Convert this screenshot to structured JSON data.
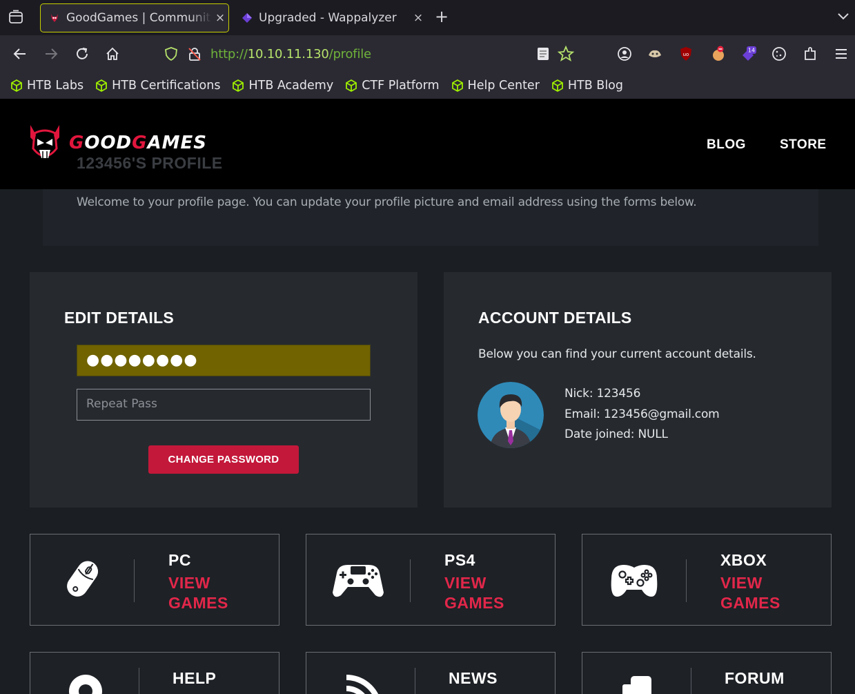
{
  "browser": {
    "tabs": [
      {
        "title": "GoodGames | Community and Store HTML Game Template",
        "active": true
      },
      {
        "title": "Upgraded - Wappalyzer",
        "active": false
      }
    ],
    "close_glyph": "×",
    "new_tab_glyph": "+",
    "url_prefix": "http://",
    "url_host": "10.10.11.130",
    "url_path": "/profile",
    "bookmarks": [
      "HTB Labs",
      "HTB Certifications",
      "HTB Academy",
      "CTF Platform",
      "Help Center",
      "HTB Blog"
    ],
    "extension_badge": "14",
    "accent_color": "#c8d000"
  },
  "site": {
    "logo_first": "G",
    "logo_mid": "OOD",
    "logo_g2": "G",
    "logo_rest": "AMES",
    "nav": [
      "BLOG",
      "STORE"
    ],
    "profile_title": "123456'S PROFILE",
    "welcome": "Welcome to your profile page. You can update your profile picture and email address using the forms below.",
    "brand_color": "#e2163d"
  },
  "edit": {
    "title": "EDIT DETAILS",
    "password_value": "●●●●●●●●",
    "repeat_placeholder": "Repeat Pass",
    "button": "CHANGE PASSWORD"
  },
  "account": {
    "title": "ACCOUNT DETAILS",
    "description": "Below you can find your current account details.",
    "nick": "Nick: 123456",
    "email": "Email: 123456@gmail.com",
    "joined": "Date joined: NULL"
  },
  "categories": [
    {
      "name": "PC",
      "link1": "VIEW",
      "link2": "GAMES",
      "icon": "mouse-icon"
    },
    {
      "name": "PS4",
      "link1": "VIEW",
      "link2": "GAMES",
      "icon": "ps4-controller-icon"
    },
    {
      "name": "XBOX",
      "link1": "VIEW",
      "link2": "GAMES",
      "icon": "xbox-controller-icon"
    },
    {
      "name": "HELP",
      "icon": "lifebuoy-icon"
    },
    {
      "name": "NEWS",
      "icon": "rss-icon"
    },
    {
      "name": "FORUM",
      "icon": "forum-icon"
    }
  ]
}
